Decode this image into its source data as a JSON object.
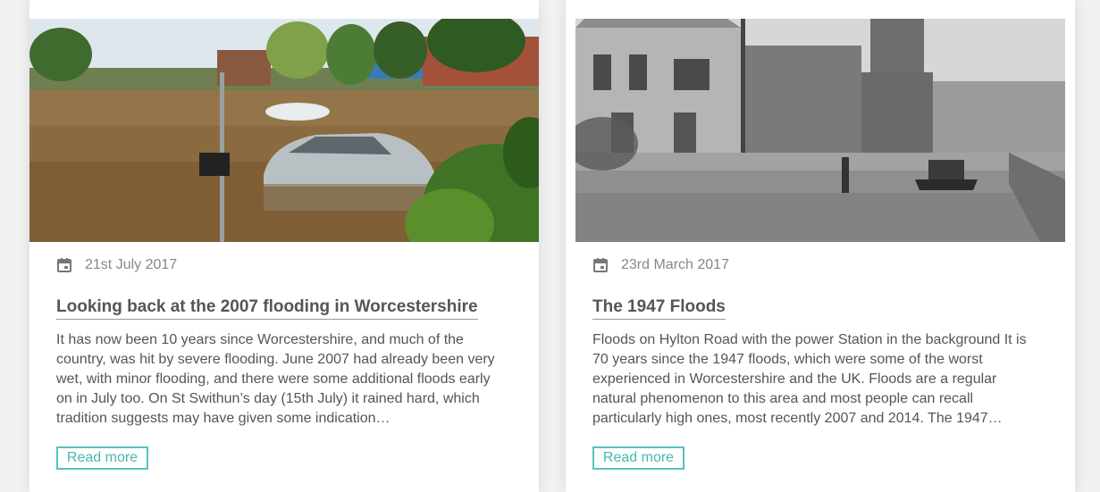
{
  "accent_color": "#56c2c0",
  "posts": [
    {
      "date": "21st July 2017",
      "date_icon": "calendar-icon",
      "title": "Looking back at the 2007 flooding in Worcestershire",
      "excerpt": "It has now been 10 years since Worcestershire, and much of the country, was hit by severe flooding. June 2007 had already been very wet, with minor flooding, and there were some additional floods early on in July too. On St Swithun’s day (15th July) it rained hard, which tradition suggests may have given some indication…",
      "read_more": "Read more"
    },
    {
      "date": "23rd March 2017",
      "date_icon": "calendar-icon",
      "title": "The 1947 Floods",
      "excerpt": "Floods on Hylton Road with the power Station in the background It is 70 years since the 1947 floods, which were some of the worst experienced in Worcestershire and the UK. Floods are a regular natural phenomenon to this area and most people can recall particularly high ones, most recently 2007 and 2014. The 1947…",
      "read_more": "Read more"
    }
  ]
}
